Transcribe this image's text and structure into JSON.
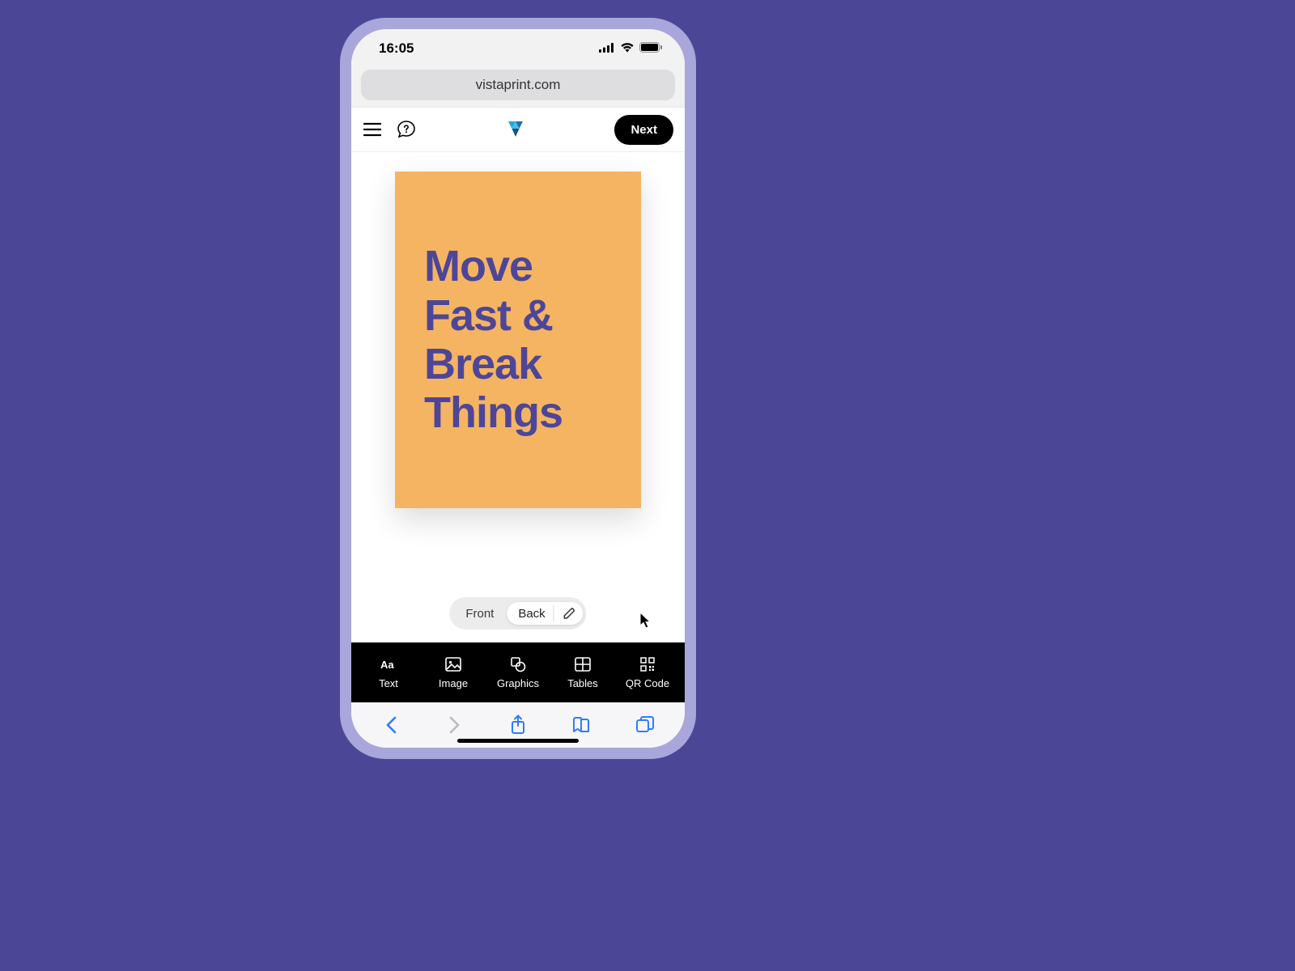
{
  "statusbar": {
    "time": "16:05"
  },
  "browser": {
    "url": "vistaprint.com"
  },
  "header": {
    "next_label": "Next"
  },
  "canvas": {
    "card_text": "Move\nFast &\nBreak\nThings",
    "card_bg": "#f4b462",
    "card_text_color": "#4d4698"
  },
  "side_toggle": {
    "front_label": "Front",
    "back_label": "Back"
  },
  "toolbar": {
    "items": [
      {
        "label": "Text"
      },
      {
        "label": "Image"
      },
      {
        "label": "Graphics"
      },
      {
        "label": "Tables"
      },
      {
        "label": "QR Code"
      }
    ]
  }
}
